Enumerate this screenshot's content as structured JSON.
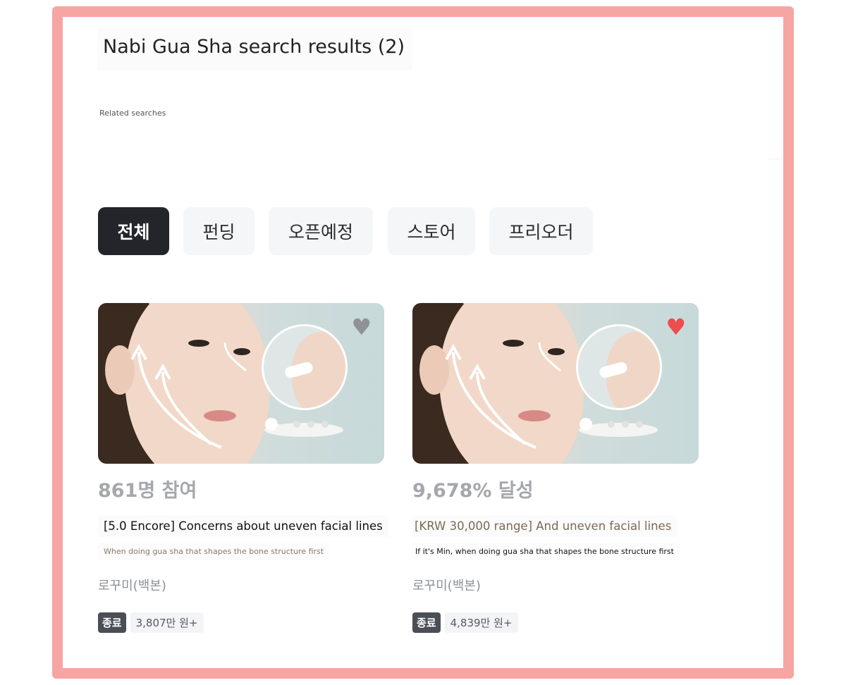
{
  "page": {
    "title": "Nabi Gua Sha search results (2)",
    "related_label": "Related searches"
  },
  "tabs": [
    {
      "label": "전체",
      "active": true
    },
    {
      "label": "펀딩",
      "active": false
    },
    {
      "label": "오픈예정",
      "active": false
    },
    {
      "label": "스토어",
      "active": false
    },
    {
      "label": "프리오더",
      "active": false
    }
  ],
  "cards": [
    {
      "stat": "861명 참여",
      "headline": "[5.0 Encore] Concerns about uneven facial lines",
      "subtitle": "When doing gua sha that shapes the bone structure first",
      "maker": "로꾸미(백본)",
      "status_badge": "종료",
      "amount": "3,807만 원+",
      "liked": false,
      "heart_color": "#8f9296"
    },
    {
      "stat": "9,678% 달성",
      "headline": "[KRW 30,000 range] And uneven facial lines",
      "subtitle": "If it's Min, when doing gua sha that shapes the bone structure first",
      "maker": "로꾸미(백본)",
      "status_badge": "종료",
      "amount": "4,839만 원+",
      "liked": true,
      "heart_color": "#ec4d4d"
    }
  ],
  "colors": {
    "frame_border": "#f6a5a2",
    "tab_active_bg": "#23252a",
    "tab_bg": "#f5f6f8",
    "stat_text": "#a5a7ab",
    "badge_bg": "#4a4f56"
  }
}
